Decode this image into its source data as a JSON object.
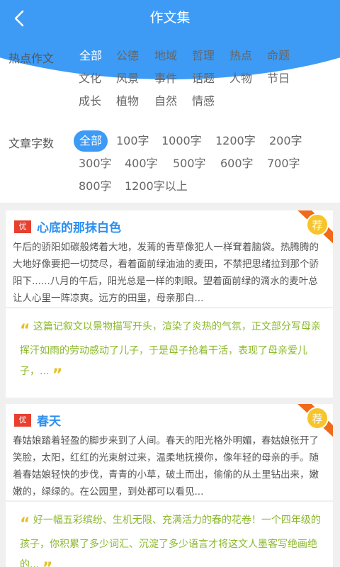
{
  "header": {
    "title": "作文集"
  },
  "filters": {
    "topic": {
      "label": "热点作文",
      "options": [
        "全部",
        "公德",
        "地域",
        "哲理",
        "热点",
        "命题",
        "文化",
        "风景",
        "事件",
        "话题",
        "人物",
        "节日",
        "成长",
        "植物",
        "自然",
        "情感"
      ],
      "selected": "全部"
    },
    "words": {
      "label": "文章字数",
      "options": [
        "全部",
        "100字",
        "1000字",
        "1200字",
        "200字",
        "300字",
        "400字",
        "500字",
        "600字",
        "700字",
        "800字",
        "1200字以上"
      ],
      "selected": "全部"
    }
  },
  "articles": [
    {
      "badge": "优",
      "title": "心底的那抹白色",
      "recommend_label": "荐",
      "excerpt": "午后的骄阳如碳般烤着大地，发蔫的青草像犯人一样耷着脑袋。热腾腾的大地好像要把一切焚尽，看着面前绿油油的麦田，不禁把思绪拉到那个骄阳下......八月的午后，阳光总是一样的刺眼。望着面前绿的滴水的麦叶总让人心里一阵凉爽。远方的田里，母亲那白...",
      "comment": "这篇记叙文以景物描写开头，渲染了炎热的气氛，正文部分写母亲挥汗如雨的劳动感动了儿子，于是母子抢着干活，表现了母亲爱儿子，..."
    },
    {
      "badge": "优",
      "title": "春天",
      "recommend_label": "荐",
      "excerpt": "春姑娘踏着轻盈的脚步来到了人间。春天的阳光格外明媚，春姑娘张开了笑脸，太阳，红红的光束射过来，温柔地抚摸你，像年轻的母亲的手。随着春姑娘轻快的步伐，青青的小草，破土而出，偷偷的从土里钻出来，嫩嫩的，绿绿的。在公园里，到处都可以看见...",
      "comment": "好一幅五彩缤纷、生机无限、充满活力的春的花卷！一个四年级的孩子，你积累了多少词汇、沉淀了多少语言才将这文人墨客写绝画绝的..."
    }
  ],
  "colors": {
    "primary": "#3d9bf5",
    "title_blue": "#2d8ff0",
    "badge_red": "#e8402f",
    "comment_green": "#8ab829",
    "quote_gold": "#e6c02a",
    "ribbon_orange": "#f06a1a"
  }
}
